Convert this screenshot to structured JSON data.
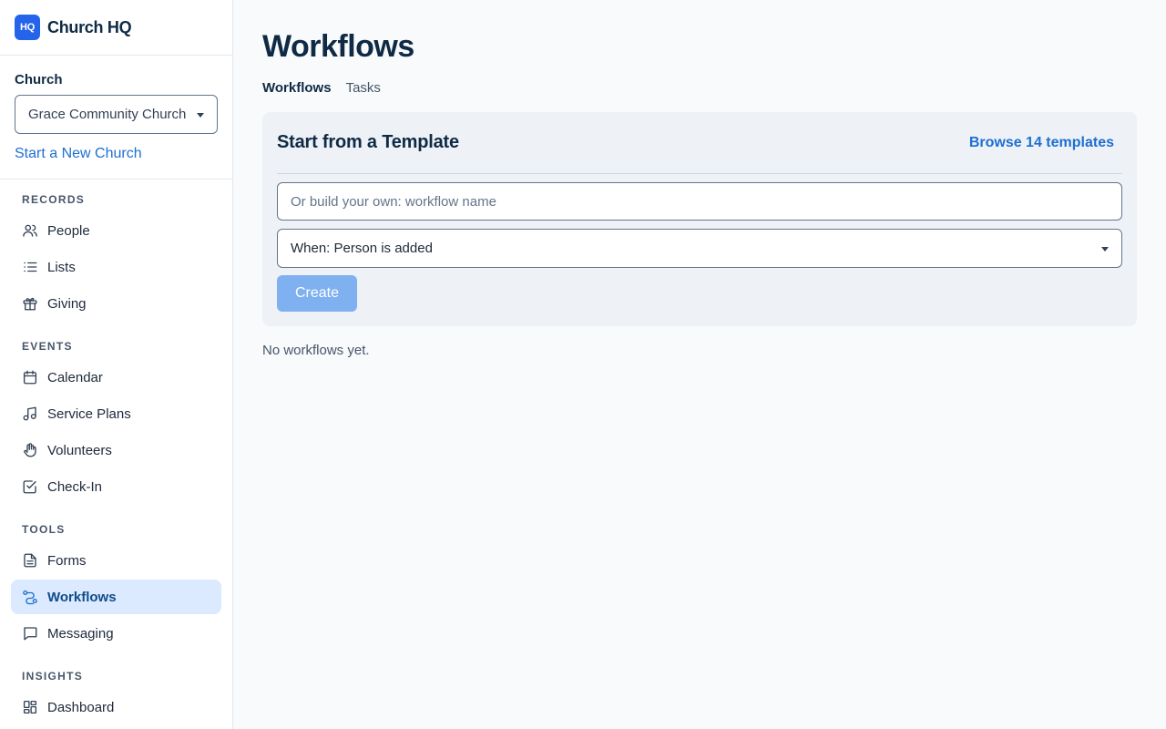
{
  "brand": {
    "logo_text": "HQ",
    "name": "Church HQ"
  },
  "church": {
    "label": "Church",
    "selected": "Grace Community Church (",
    "new_church_link": "Start a New Church"
  },
  "sidebar": {
    "sections": [
      {
        "title": "RECORDS",
        "items": [
          {
            "label": "People",
            "icon": "users-icon"
          },
          {
            "label": "Lists",
            "icon": "list-icon"
          },
          {
            "label": "Giving",
            "icon": "gift-icon"
          }
        ]
      },
      {
        "title": "EVENTS",
        "items": [
          {
            "label": "Calendar",
            "icon": "calendar-icon"
          },
          {
            "label": "Service Plans",
            "icon": "music-note-icon"
          },
          {
            "label": "Volunteers",
            "icon": "hand-icon"
          },
          {
            "label": "Check-In",
            "icon": "check-square-icon"
          }
        ]
      },
      {
        "title": "TOOLS",
        "items": [
          {
            "label": "Forms",
            "icon": "document-icon"
          },
          {
            "label": "Workflows",
            "icon": "workflow-icon",
            "active": true
          },
          {
            "label": "Messaging",
            "icon": "message-icon"
          }
        ]
      },
      {
        "title": "INSIGHTS",
        "items": [
          {
            "label": "Dashboard",
            "icon": "dashboard-icon"
          }
        ]
      }
    ]
  },
  "page": {
    "title": "Workflows",
    "tabs": [
      {
        "label": "Workflows",
        "active": true
      },
      {
        "label": "Tasks",
        "active": false
      }
    ]
  },
  "template_card": {
    "title": "Start from a Template",
    "browse_link": "Browse 14 templates",
    "name_placeholder": "Or build your own: workflow name",
    "trigger_selected": "When: Person is added",
    "create_label": "Create"
  },
  "empty_state": "No workflows yet.",
  "colors": {
    "accent": "#1d6fd1",
    "brand": "#2563eb",
    "active_bg": "#dbeafe",
    "button_disabled": "#7fb0ef"
  }
}
